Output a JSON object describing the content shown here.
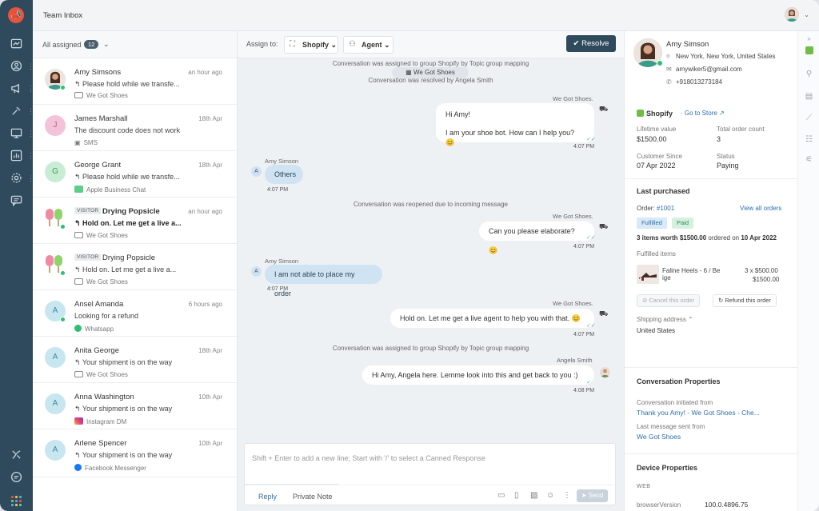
{
  "header": {
    "title": "Team Inbox"
  },
  "list": {
    "filter_label": "All assigned",
    "filter_count": "12",
    "conversations": [
      {
        "name": "Amy Simsons",
        "time": "an hour ago",
        "message": "Please hold while we transfe...",
        "channel": "We Got Shoes",
        "initial": ""
      },
      {
        "name": "James Marshall",
        "time": "18th Apr",
        "message": "The discount code does not work",
        "channel": "SMS",
        "initial": "J"
      },
      {
        "name": "George Grant",
        "time": "18th Apr",
        "message": "Please hold while we transfe...",
        "channel": "Apple Business Chat",
        "initial": "G"
      },
      {
        "name": "Drying Popsicle",
        "visitor": "VISITOR",
        "time": "an hour ago",
        "message": "Hold on. Let me get a live a...",
        "channel": "We Got Shoes",
        "initial": ""
      },
      {
        "name": "Drying Popsicle",
        "visitor": "VISITOR",
        "time": "",
        "message": "Hold on. Let me get a live a...",
        "channel": "We Got Shoes",
        "initial": ""
      },
      {
        "name": "Ansel Amanda",
        "time": "6 hours ago",
        "message": "Looking for a refund",
        "channel": "Whatsapp",
        "initial": "A"
      },
      {
        "name": "Anita George",
        "time": "18th Apr",
        "message": "Your shipment is on the way",
        "channel": "We Got Shoes",
        "initial": "A"
      },
      {
        "name": "Anna Washington",
        "time": "10th Apr",
        "message": "Your shipment is on the way",
        "channel": "Instagram DM",
        "initial": "A"
      },
      {
        "name": "Arlene Spencer",
        "time": "10th Apr",
        "message": "Your shipment is on the way",
        "channel": "Facebook Messenger",
        "initial": "A"
      }
    ]
  },
  "toolbar": {
    "assign_label": "Assign to:",
    "group": "Shopify",
    "agent": "Agent",
    "resolve": "Resolve"
  },
  "chat": {
    "sys1": "Conversation was assigned to group Shopify by Topic group mapping",
    "tag": "We Got Shoes",
    "sys2": "Conversation was resolved by Angela Smith",
    "m1_sender": "We Got Shoes.",
    "m1_line1": "Hi Amy!",
    "m1_line2": "I am your shoe bot. How can I help you? 😊",
    "m1_time": "4:07 PM",
    "m2_sender": "Amy Simson",
    "m2_text": "Others",
    "m2_time": "4:07 PM",
    "sys3": "Conversation was reopened due to incoming message",
    "m3_sender": "We Got Shoes.",
    "m3_text": "Can you please elaborate? 😊",
    "m3_time": "4:07 PM",
    "m4_sender": "Amy Simson",
    "m4_text": "I am not able to place my order",
    "m4_time": "4:07 PM",
    "m5_sender": "We Got Shoes.",
    "m5_text": "Hold on. Let me get a live agent to help you with that. 😊",
    "m5_time": "4:07 PM",
    "sys4": "Conversation was assigned to group Shopify by Topic group mapping",
    "m6_sender": "Angela Smith",
    "m6_text": "Hi Amy, Angela here. Lemme look into this and get back to you :)",
    "m6_time": "4:08 PM",
    "avatar_initial": "A"
  },
  "composer": {
    "placeholder": "Shift + Enter to add a new line; Start with '/' to select a Canned Response",
    "tab_reply": "Reply",
    "tab_note": "Private Note",
    "send": "Send"
  },
  "contact": {
    "name": "Amy Simson",
    "location": "New York, New York, United States",
    "email": "amywiker5@gmail.com",
    "phone": "+918013273184",
    "shop": "Shopify",
    "goto": "Go to Store",
    "lifetime_label": "Lifetime value",
    "lifetime_value": "$1500.00",
    "orders_label": "Total order count",
    "orders_value": "3",
    "since_label": "Customer Since",
    "since_value": "07 Apr 2022",
    "status_label": "Status",
    "status_value": "Paying",
    "last_purchased": "Last purchased",
    "order_label": "Order:",
    "order_id": "#1001",
    "view_all": "View all orders",
    "fulfilled": "Fulfilled",
    "paid": "Paid",
    "summary_pre": "3 items worth",
    "summary_amount": "$1500.00",
    "summary_mid": "ordered on",
    "summary_date": "10 Apr 2022",
    "fulfilled_items": "Fulfilled items",
    "item_name_1": "Faline Heels - 6 / Be",
    "item_name_2": "ige",
    "item_qty": "3 x $500.00",
    "item_total": "$1500.00",
    "cancel": "Cancel this order",
    "refund": "Refund this order",
    "shipping_label": "Shipping address",
    "shipping_value": "United States",
    "conv_props": "Conversation Properties",
    "initiated_label": "Conversation initiated from",
    "initiated_value": "Thank you Amy! - We Got Shoes - Che...",
    "last_msg_label": "Last message sent from",
    "last_msg_value": "We Got Shoes",
    "device_props": "Device Properties",
    "web": "WEB",
    "browser_label": "browserVersion",
    "browser_value": "100.0.4896.75"
  }
}
